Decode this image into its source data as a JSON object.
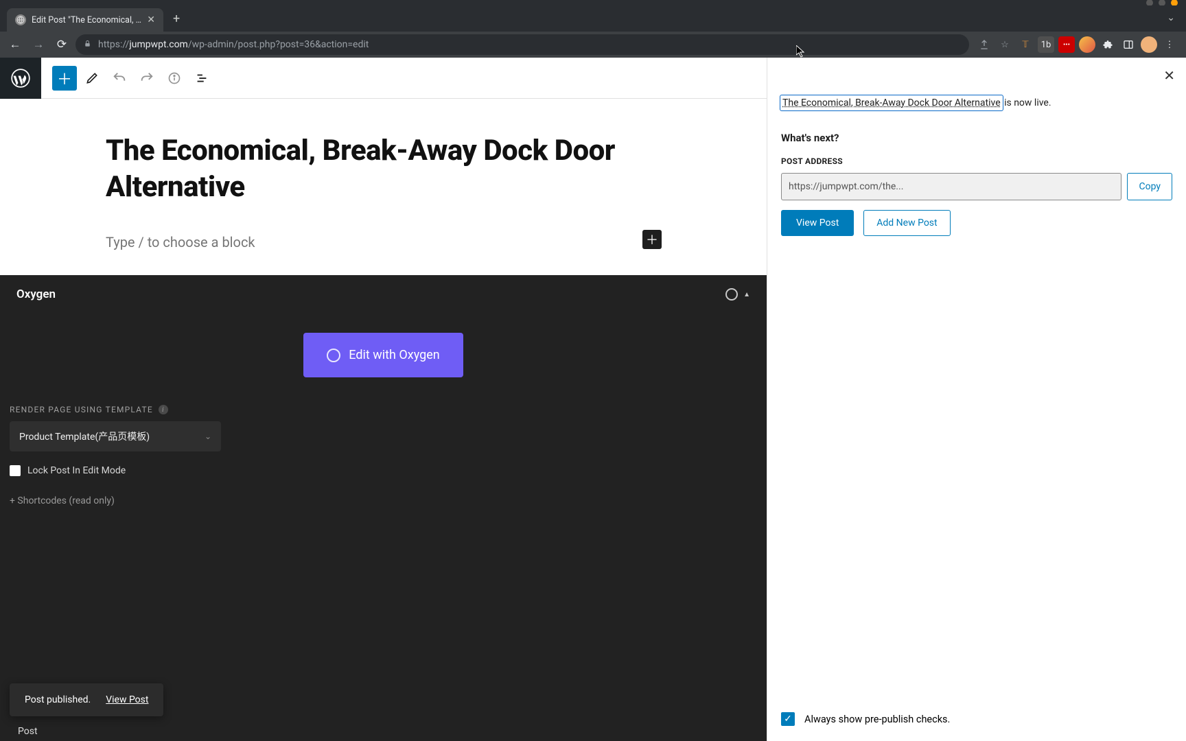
{
  "browser": {
    "tab_title": "Edit Post \"The Economical, Bre",
    "url_host": "jumpwpt.com",
    "url_path": "/wp-admin/post.php?post=36&action=edit",
    "url_full": "https://jumpwpt.com/wp-admin/post.php?post=36&action=edit"
  },
  "editor": {
    "post_title": "The Economical, Break-Away Dock Door Alternative",
    "placeholder": "Type / to choose a block",
    "footer_tab": "Post"
  },
  "oxygen": {
    "panel_title": "Oxygen",
    "cta_label": "Edit with Oxygen",
    "render_label": "RENDER PAGE USING TEMPLATE",
    "template_selected": "Product Template(产品页模板)",
    "lock_label": "Lock Post In Edit Mode",
    "shortcodes_label": "+ Shortcodes (read only)"
  },
  "snackbar": {
    "message": "Post published.",
    "action": "View Post"
  },
  "sidebar": {
    "live_link_text": "The Economical, Break-Away Dock Door Alternative",
    "live_suffix": " is now live.",
    "whats_next": "What's next?",
    "post_address_label": "POST ADDRESS",
    "post_address_value": "https://jumpwpt.com/the...",
    "copy_label": "Copy",
    "view_post_label": "View Post",
    "add_new_label": "Add New Post",
    "always_show_label": "Always show pre-publish checks."
  }
}
